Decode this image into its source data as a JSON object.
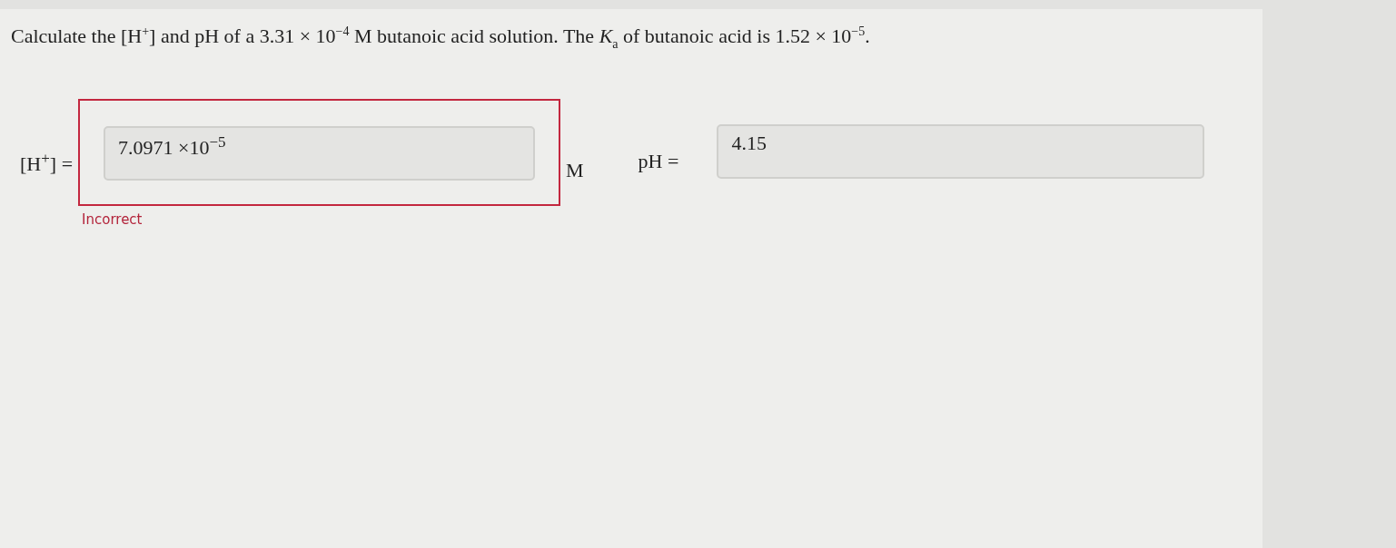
{
  "question": "Calculate the [H$^{+}$] and pH of a 3.31 × 10$^{−4}$ M butanoic acid solution. The *K*$_{a}$ of butanoic acid is 1.52 × 10$^{−5}$.",
  "answers": [
    {
      "label": "[H$^{+}$] =",
      "value": "7.0971 ×10$^{−5}$",
      "unit": "M",
      "incorrect": true,
      "feedback": "Incorrect"
    },
    {
      "label": "pH =",
      "value": "4.15",
      "incorrect": false
    }
  ]
}
